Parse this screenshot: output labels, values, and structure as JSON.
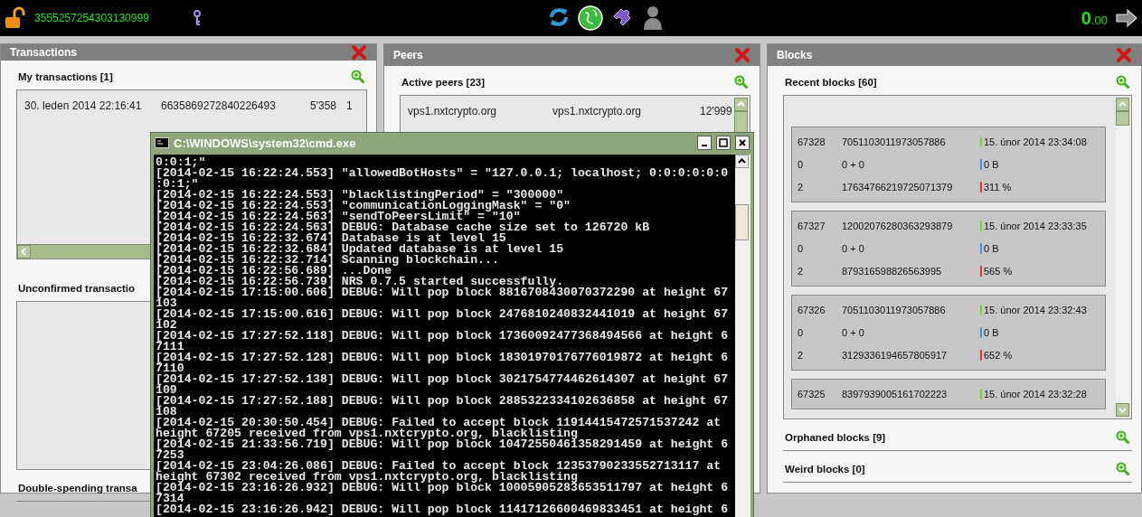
{
  "top_bar": {
    "account": "3555257254303130999",
    "balance_whole": "0",
    "balance_fraction": ".00"
  },
  "panels": [
    {
      "title": "Transactions",
      "sections": [
        {
          "kind": "table",
          "title": "My transactions [1]",
          "rows": [
            [
              "30. leden 2014 22:16:41",
              "6635869272840226493",
              "5'358",
              "1"
            ]
          ]
        },
        {
          "kind": "empty",
          "title": "Unconfirmed transactio",
          "zoom_icon": false
        },
        {
          "kind": "header",
          "title": "Double-spending transa",
          "zoom_icon": false
        }
      ]
    },
    {
      "title": "Peers",
      "sections": [
        {
          "kind": "peers",
          "title": "Active peers [23]",
          "rows": [
            [
              "vps1.nxtcrypto.org",
              "vps1.nxtcrypto.org",
              "12'999"
            ]
          ]
        }
      ]
    },
    {
      "title": "Blocks",
      "sections": [
        {
          "kind": "blocks",
          "title": "Recent blocks [60]",
          "cards": [
            {
              "cells": [
                {
                  "text": "67328"
                },
                {
                  "text": "7051103011973057886"
                },
                {
                  "text": "15. únor 2014 23:34:08",
                  "color": "#7ccf3a"
                },
                {
                  "text": "0"
                },
                {
                  "text": "0 + 0"
                },
                {
                  "text": "0 B",
                  "color": "#4a90e0"
                },
                {
                  "text": "2"
                },
                {
                  "text": "17634766219725071379"
                },
                {
                  "text": "311 %",
                  "color": "#e03030"
                }
              ]
            },
            {
              "cells": [
                {
                  "text": "67327"
                },
                {
                  "text": "12002076280363293879"
                },
                {
                  "text": "15. únor 2014 23:33:35",
                  "color": "#7ccf3a"
                },
                {
                  "text": "0"
                },
                {
                  "text": "0 + 0"
                },
                {
                  "text": "0 B",
                  "color": "#4a90e0"
                },
                {
                  "text": "2"
                },
                {
                  "text": "879316598826563995"
                },
                {
                  "text": "565 %",
                  "color": "#e03030"
                }
              ]
            },
            {
              "cells": [
                {
                  "text": "67326"
                },
                {
                  "text": "7051103011973057886"
                },
                {
                  "text": "15. únor 2014 23:32:43",
                  "color": "#7ccf3a"
                },
                {
                  "text": "0"
                },
                {
                  "text": "0 + 0"
                },
                {
                  "text": "0 B",
                  "color": "#4a90e0"
                },
                {
                  "text": "2"
                },
                {
                  "text": "3129336194657805917"
                },
                {
                  "text": "652 %",
                  "color": "#e03030"
                }
              ]
            },
            {
              "cells": [
                {
                  "text": "67325"
                },
                {
                  "text": "8397939005161702223"
                },
                {
                  "text": "15. únor 2014 23:32:28",
                  "color": "#7ccf3a"
                }
              ]
            }
          ]
        },
        {
          "kind": "header",
          "title": "Orphaned blocks [9]"
        },
        {
          "kind": "header",
          "title": "Weird blocks [0]"
        }
      ]
    }
  ],
  "console": {
    "title": "C:\\WINDOWS\\system32\\cmd.exe",
    "lines": [
      "0:0:1;\"",
      "[2014-02-15 16:22:24.553] \"allowedBotHosts\" = \"127.0.0.1; localhost; 0:0:0:0:0:0",
      ":0:1;\"",
      "[2014-02-15 16:22:24.553] \"blacklistingPeriod\" = \"300000\"",
      "[2014-02-15 16:22:24.553] \"communicationLoggingMask\" = \"0\"",
      "[2014-02-15 16:22:24.563] \"sendToPeersLimit\" = \"10\"",
      "[2014-02-15 16:22:24.563] DEBUG: Database cache size set to 126720 kB",
      "[2014-02-15 16:22:32.674] Database is at level 15",
      "[2014-02-15 16:22:32.684] Updated database is at level 15",
      "[2014-02-15 16:22:32.714] Scanning blockchain...",
      "[2014-02-15 16:22:56.689] ...Done",
      "[2014-02-15 16:22:56.739] NRS 0.7.5 started successfully.",
      "[2014-02-15 17:15:00.606] DEBUG: Will pop block 8816708430070372290 at height 67",
      "103",
      "[2014-02-15 17:15:00.616] DEBUG: Will pop block 2476810240832441019 at height 67",
      "102",
      "[2014-02-15 17:27:52.118] DEBUG: Will pop block 17360092477368494566 at height 6",
      "7111",
      "[2014-02-15 17:27:52.128] DEBUG: Will pop block 18301970176776019872 at height 6",
      "7110",
      "[2014-02-15 17:27:52.138] DEBUG: Will pop block 3021754774462614307 at height 67",
      "109",
      "[2014-02-15 17:27:52.188] DEBUG: Will pop block 2885322334102636858 at height 67",
      "108",
      "[2014-02-15 20:30:50.454] DEBUG: Failed to accept block 11914415472571537242 at",
      "height 67205 received from vps1.nxtcrypto.org, blacklisting",
      "[2014-02-15 21:33:56.719] DEBUG: Will pop block 10472550461358291459 at height 6",
      "7253",
      "[2014-02-15 23:04:26.086] DEBUG: Failed to accept block 12353790233552713117 at",
      "height 67302 received from vps1.nxtcrypto.org, blacklisting",
      "[2014-02-15 23:16:26.932] DEBUG: Will pop block 10005905283653511797 at height 6",
      "7314",
      "[2014-02-15 23:16:26.942] DEBUG: Will pop block 11417126600469833451 at height 6"
    ]
  }
}
